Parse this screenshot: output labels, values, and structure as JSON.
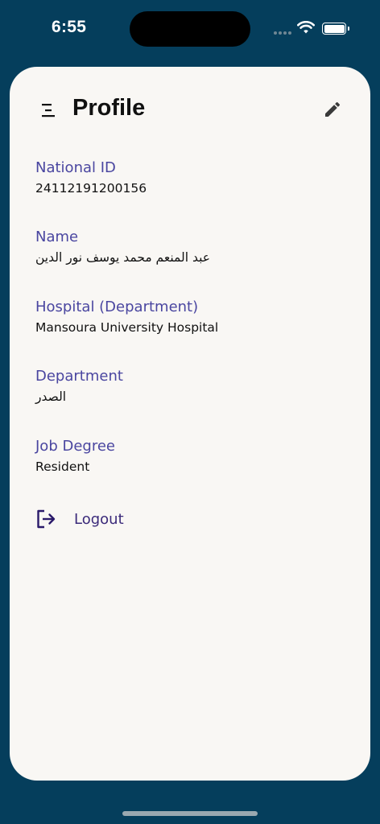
{
  "status_bar": {
    "time": "6:55"
  },
  "header": {
    "title": "Profile"
  },
  "fields": [
    {
      "label": "National ID",
      "value": "24112191200156"
    },
    {
      "label": "Name",
      "value": "عبد المنعم محمد يوسف نور الدين"
    },
    {
      "label": "Hospital (Department)",
      "value": "Mansoura University Hospital"
    },
    {
      "label": "Department",
      "value": "الصدر"
    },
    {
      "label": "Job Degree",
      "value": "Resident"
    }
  ],
  "logout": {
    "label": "Logout"
  },
  "colors": {
    "background": "#053e5c",
    "card": "#f9f7f4",
    "label": "#4a46a0",
    "value": "#111111",
    "logout": "#3b2a7a"
  },
  "icons": [
    "menu-icon",
    "edit-pencil-icon",
    "logout-icon",
    "wifi-icon",
    "battery-icon"
  ]
}
